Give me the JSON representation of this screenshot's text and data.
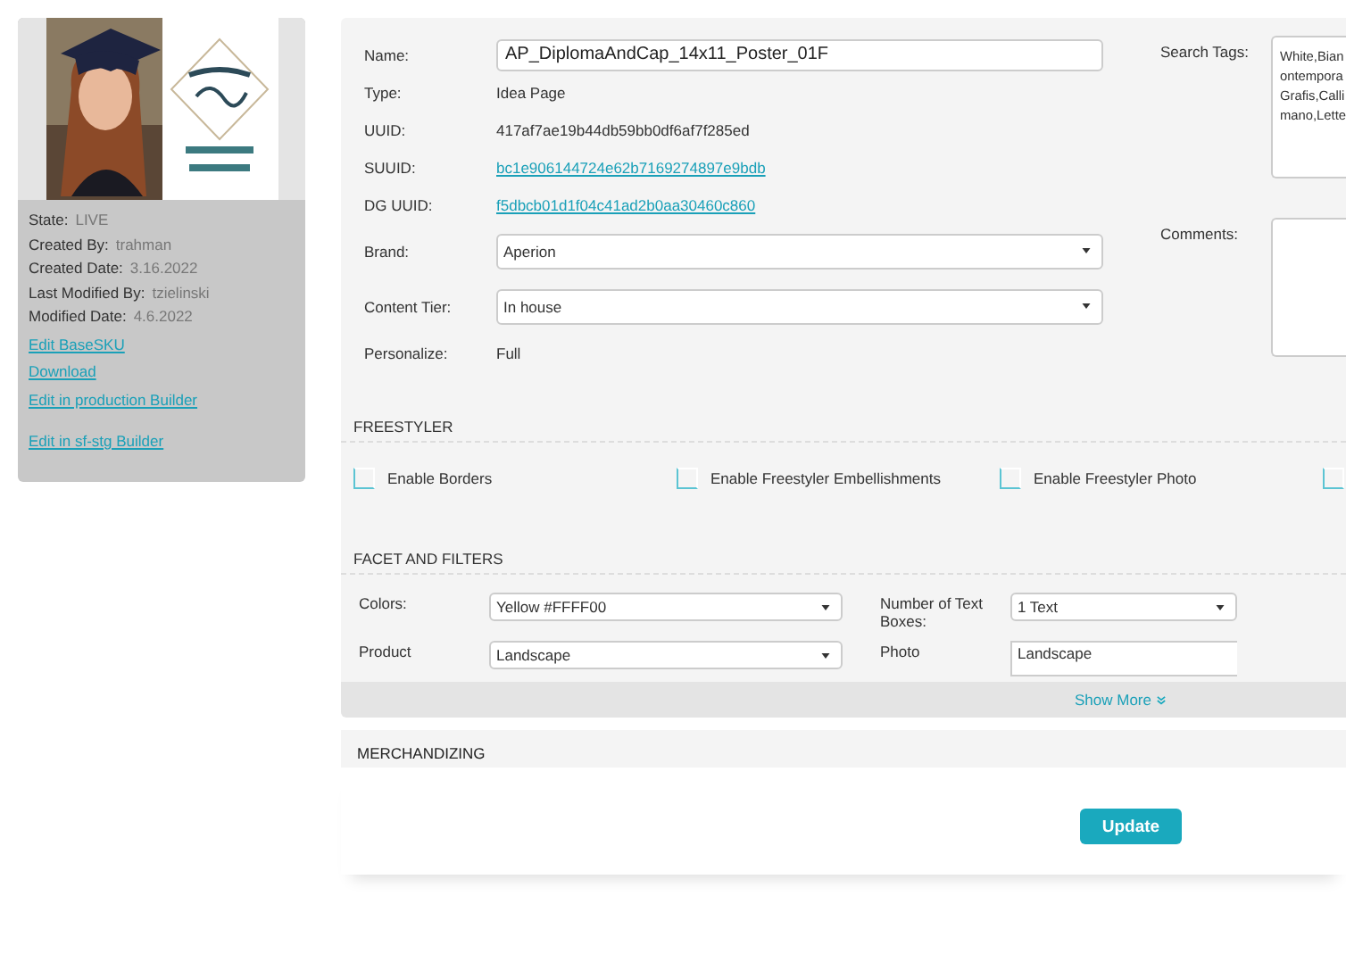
{
  "sidebar": {
    "thumbnail": {
      "kind": "picture"
    },
    "details": [
      {
        "label": "State:",
        "value": "LIVE"
      },
      {
        "label": "Created By:",
        "value": "trahman"
      },
      {
        "label": "Created Date:",
        "value": "3.16.2022"
      },
      {
        "label": "Last Modified By:",
        "value": "tzielinski"
      },
      {
        "label": "Modified Date:",
        "value": "4.6.2022"
      }
    ],
    "links": [
      "Edit BaseSKU",
      "Download",
      "Edit in production Builder",
      "Edit in sf-stg Builder"
    ]
  },
  "fields": [
    {
      "kind": "input",
      "label": "Name:",
      "value": "AP_DiplomaAndCap_14x11_Poster_01F"
    },
    {
      "kind": "text",
      "label": "Type:",
      "value": "Idea Page"
    },
    {
      "kind": "text",
      "label": "UUID:",
      "value": "417af7ae19b44db59bb0df6af7f285ed"
    },
    {
      "kind": "link",
      "label": "SUUID:",
      "value": "bc1e906144724e62b7169274897e9bdb"
    },
    {
      "kind": "link",
      "label": "DG UUID:",
      "value": "f5dbcb01d1f04c41ad2b0aa30460c860"
    },
    {
      "kind": "select",
      "label": "Brand:",
      "value": "Aperion"
    },
    {
      "kind": "select",
      "label": "Content Tier:",
      "value": "In house"
    },
    {
      "kind": "text",
      "label": "Personalize:",
      "value": "Full"
    }
  ],
  "side_fields": [
    {
      "label": "Search Tags:",
      "lines": [
        "White,Bian",
        "ontempora",
        "Grafis,Calli",
        "mano,Lette"
      ]
    },
    {
      "label": "Comments:"
    }
  ],
  "freestyler": {
    "title": "FREESTYLER",
    "options": [
      {
        "label": "Enable Borders",
        "checked": false
      },
      {
        "label": "Enable Freestyler Embellishments",
        "checked": false
      },
      {
        "label": "Enable Freestyler Photo",
        "checked": false
      },
      {
        "checked": false
      }
    ]
  },
  "facets": {
    "title": "FACET AND FILTERS",
    "rows": [
      {
        "kind": "select",
        "label": "Colors:",
        "value": "Yellow #FFFF00"
      },
      {
        "kind": "select",
        "label": "Number of Text Boxes:",
        "value": "1 Text"
      },
      {
        "kind": "select",
        "label": "Product",
        "value": "Landscape"
      },
      {
        "kind": "listbox",
        "label": "Photo",
        "value": "Landscape"
      }
    ]
  },
  "show_more": "Show More",
  "merchandizing": {
    "title": "MERCHANDIZING"
  },
  "update_button": "Update"
}
